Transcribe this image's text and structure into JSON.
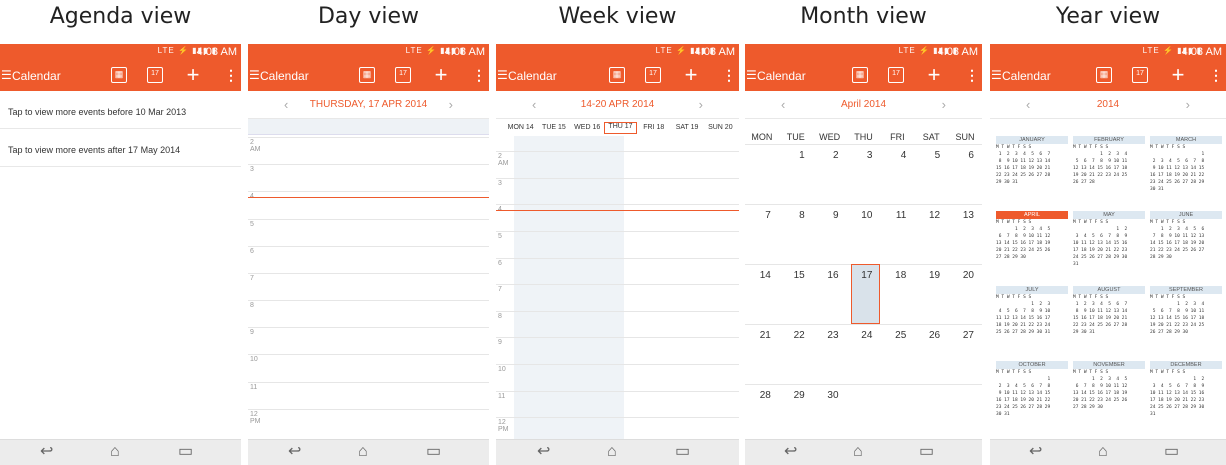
{
  "status": {
    "time": "4:08 AM",
    "signal": "LTE"
  },
  "appbar": {
    "title": "Calendar"
  },
  "panels": {
    "agenda": {
      "caption": "Agenda view",
      "items": [
        "Tap to view more events before 10 Mar 2013",
        "Tap to view more events after 17 May 2014"
      ]
    },
    "day": {
      "caption": "Day view",
      "date": "THURSDAY, 17 APR 2014",
      "hours": [
        "2\nAM",
        "3",
        "4",
        "5",
        "6",
        "7",
        "8",
        "9",
        "10",
        "11",
        "12\nPM"
      ]
    },
    "week": {
      "caption": "Week view",
      "range": "14-20 APR 2014",
      "days": [
        "MON 14",
        "TUE 15",
        "WED 16",
        "THU 17",
        "FRI 18",
        "SAT 19",
        "SUN 20"
      ],
      "hours": [
        "2\nAM",
        "3",
        "4",
        "5",
        "6",
        "7",
        "8",
        "9",
        "10",
        "11",
        "12\nPM"
      ]
    },
    "month": {
      "caption": "Month view",
      "title": "April 2014",
      "weekdays": [
        "MON",
        "TUE",
        "WED",
        "THU",
        "FRI",
        "SAT",
        "SUN"
      ],
      "weeks": [
        [
          "",
          "1",
          "2",
          "3",
          "4",
          "5",
          "6"
        ],
        [
          "7",
          "8",
          "9",
          "10",
          "11",
          "12",
          "13"
        ],
        [
          "14",
          "15",
          "16",
          "17",
          "18",
          "19",
          "20"
        ],
        [
          "21",
          "22",
          "23",
          "24",
          "25",
          "26",
          "27"
        ],
        [
          "28",
          "29",
          "30",
          "",
          "",
          "",
          ""
        ]
      ],
      "today": "17"
    },
    "year": {
      "caption": "Year view",
      "title": "2014",
      "months": [
        "JANUARY",
        "FEBRUARY",
        "MARCH",
        "APRIL",
        "MAY",
        "JUNE",
        "JULY",
        "AUGUST",
        "SEPTEMBER",
        "OCTOBER",
        "NOVEMBER",
        "DECEMBER"
      ],
      "current_month": "APRIL"
    }
  },
  "colors": {
    "accent": "#ee5a2c",
    "today_fill": "#d9e2ea"
  }
}
